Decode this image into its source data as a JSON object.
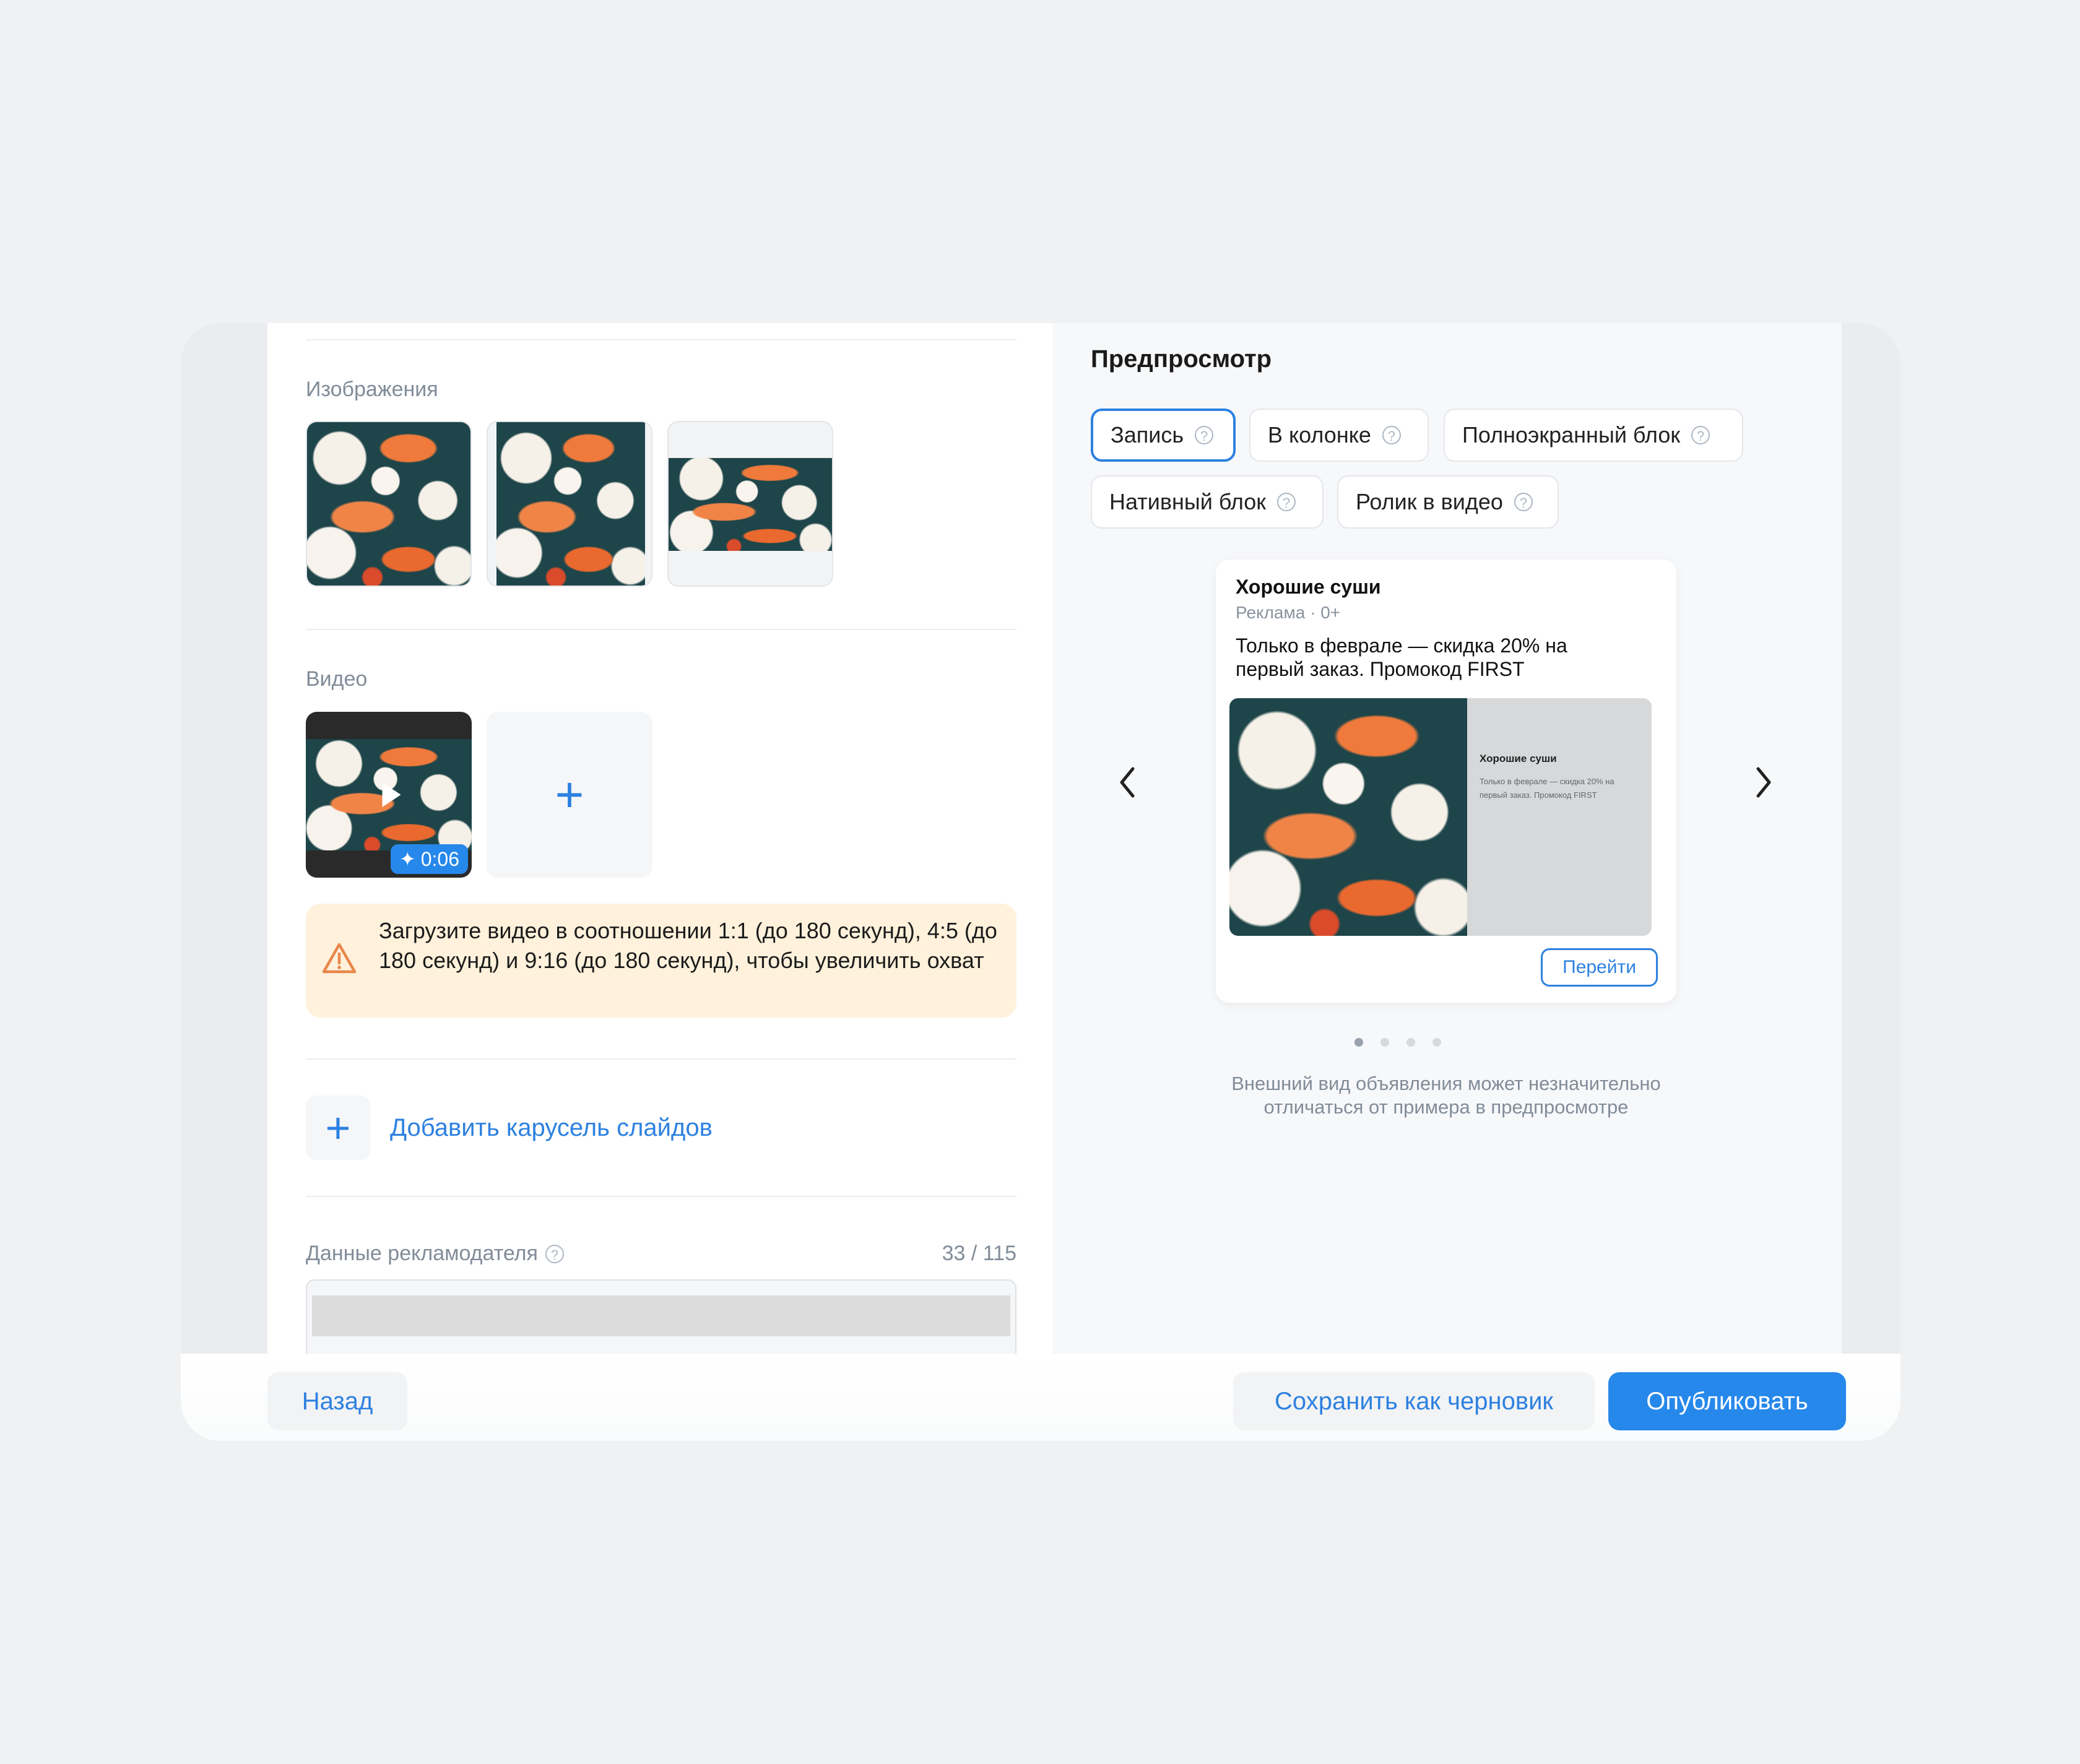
{
  "form": {
    "images_label": "Изображения",
    "video_label": "Видео",
    "video_duration": "0:06",
    "warning_text": "Загрузите видео в соотношении 1:1 (до 180 секунд), 4:5 (до 180 секунд) и 9:16 (до 180 секунд), чтобы увеличить охват",
    "add_carousel": "Добавить карусель слайдов",
    "advertiser_label": "Данные рекламодателя",
    "advertiser_count": "33 / 115"
  },
  "preview": {
    "title": "Предпросмотр",
    "tabs": [
      {
        "label": "Запись",
        "active": true
      },
      {
        "label": "В колонке",
        "active": false
      },
      {
        "label": "Полноэкранный блок",
        "active": false
      },
      {
        "label": "Нативный блок",
        "active": false
      },
      {
        "label": "Ролик в видео",
        "active": false
      }
    ],
    "ad": {
      "name": "Хорошие суши",
      "meta": "Реклама · 0+",
      "text": "Только в феврале — скидка 20% на первый заказ. Промокод FIRST",
      "media_title": "Хорошие суши",
      "media_text": "Только в феврале — скидка 20% на первый заказ. Промокод FIRST",
      "button": "Перейти"
    },
    "slides_total": 4,
    "slide_active": 1,
    "note": "Внешний вид объявления может незначительно отличаться от примера в предпросмотре"
  },
  "footer": {
    "back": "Назад",
    "save_draft": "Сохранить как черновик",
    "publish": "Опубликовать"
  },
  "colors": {
    "accent": "#2d81e0",
    "publish_bg": "#2688eb",
    "warning_bg": "#fff1db",
    "warning_icon": "#e8874b"
  }
}
